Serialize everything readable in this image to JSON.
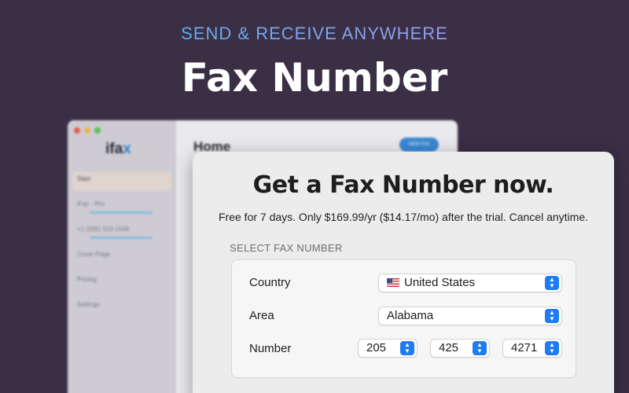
{
  "hero": {
    "subtitle": "SEND & RECEIVE ANYWHERE",
    "title": "Fax Number"
  },
  "background_app": {
    "logo_main": "ifa",
    "logo_x": "x",
    "page_title": "Home",
    "button_label": "NEW FAX",
    "sidebar_items": [
      {
        "label": "Start",
        "sub": ""
      },
      {
        "label": "iFax - Pro",
        "sub": ""
      },
      {
        "label": "+1 (205) 323-1546",
        "sub": ""
      },
      {
        "label": "Cover Page",
        "sub": ""
      },
      {
        "label": "Pricing",
        "sub": ""
      },
      {
        "label": "Settings",
        "sub": ""
      }
    ]
  },
  "panel": {
    "title": "Get a Fax Number now.",
    "description": "Free for 7 days. Only $169.99/yr ($14.17/mo) after the trial. Cancel anytime.",
    "section_label": "SELECT FAX NUMBER",
    "country": {
      "label": "Country",
      "value": "United States",
      "icon": "us-flag-icon"
    },
    "area": {
      "label": "Area",
      "value": "Alabama"
    },
    "number": {
      "label": "Number",
      "part1": "205",
      "part2": "425",
      "part3": "4271"
    }
  },
  "colors": {
    "background": "#3a2f45",
    "accent": "#1e7cf0"
  }
}
